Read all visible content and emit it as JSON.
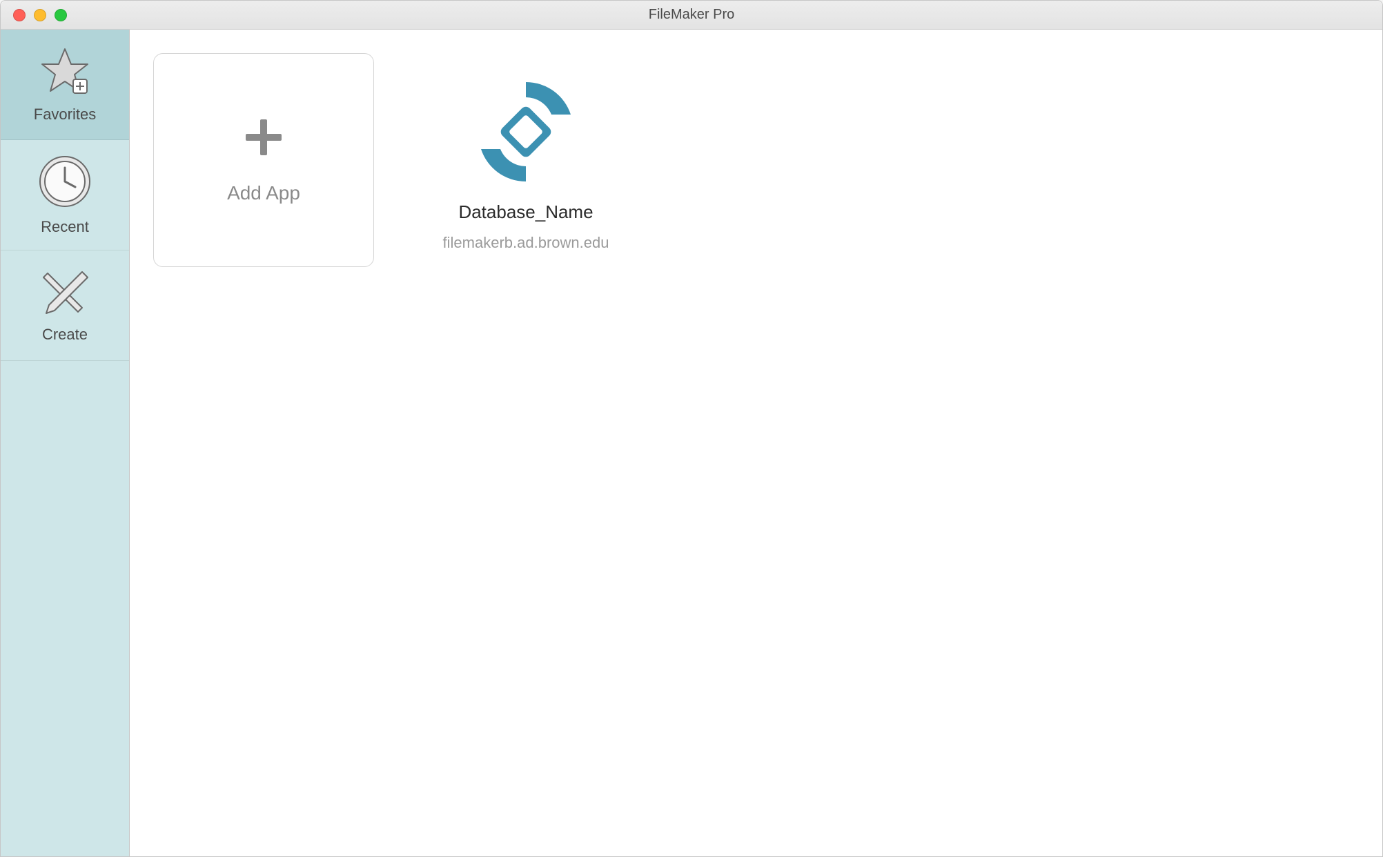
{
  "window": {
    "title": "FileMaker Pro"
  },
  "sidebar": {
    "items": [
      {
        "label": "Favorites",
        "selected": true
      },
      {
        "label": "Recent",
        "selected": false
      },
      {
        "label": "Create",
        "selected": false
      }
    ]
  },
  "content": {
    "add_app_label": "Add App",
    "favorites": [
      {
        "name": "Database_Name",
        "host": "filemakerb.ad.brown.edu"
      }
    ]
  },
  "colors": {
    "sidebar_bg": "#cee6e8",
    "sidebar_selected": "#b1d4d8",
    "accent": "#3c91b2"
  }
}
